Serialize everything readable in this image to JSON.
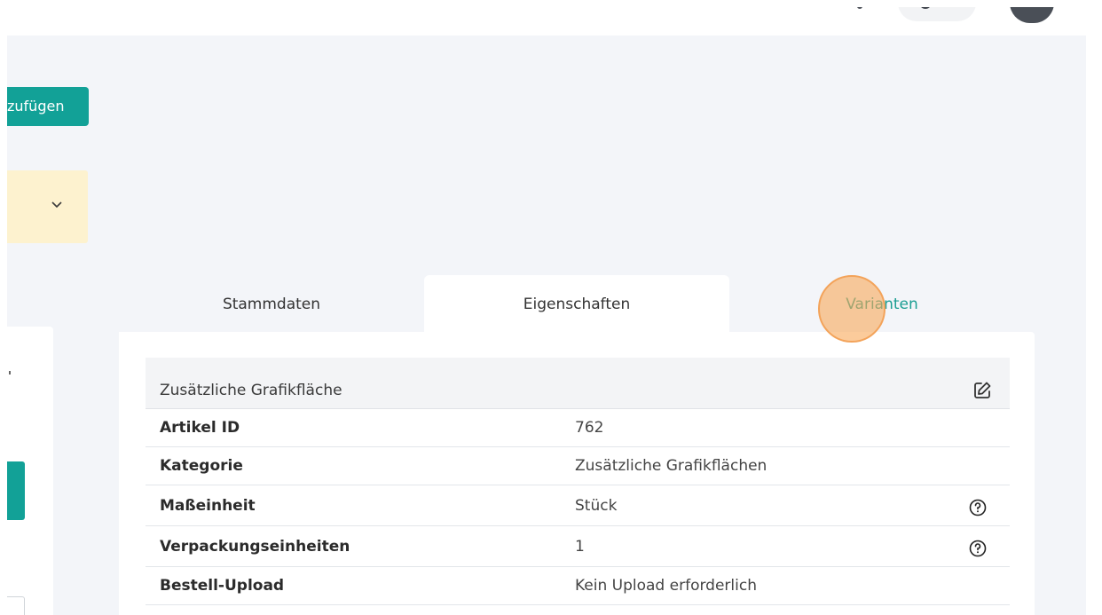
{
  "toolbar": {
    "add_button_label": "zufügen"
  },
  "tabs": [
    {
      "label": "Stammdaten",
      "active": false
    },
    {
      "label": "Eigenschaften",
      "active": true
    },
    {
      "label": "Varianten",
      "active": false,
      "highlighted": true
    }
  ],
  "properties": {
    "header_title": "Zusätzliche Grafikfläche",
    "rows": [
      {
        "key": "Artikel ID",
        "value": "762",
        "help": false
      },
      {
        "key": "Kategorie",
        "value": "Zusätzliche Grafikflächen",
        "help": false
      },
      {
        "key": "Maßeinheit",
        "value": "Stück",
        "help": true
      },
      {
        "key": "Verpackungseinheiten",
        "value": "1",
        "help": true
      },
      {
        "key": "Bestell-Upload",
        "value": "Kein Upload erforderlich",
        "help": false
      }
    ]
  },
  "icons": {
    "notice_chevron": "chevron-down-icon",
    "edit": "edit-icon",
    "help": "help-circle-icon"
  },
  "colors": {
    "accent": "#12a197",
    "active_tab_text": "#1b9e93",
    "notice_bg": "#fdf2cf",
    "background": "#f3f5f9"
  }
}
